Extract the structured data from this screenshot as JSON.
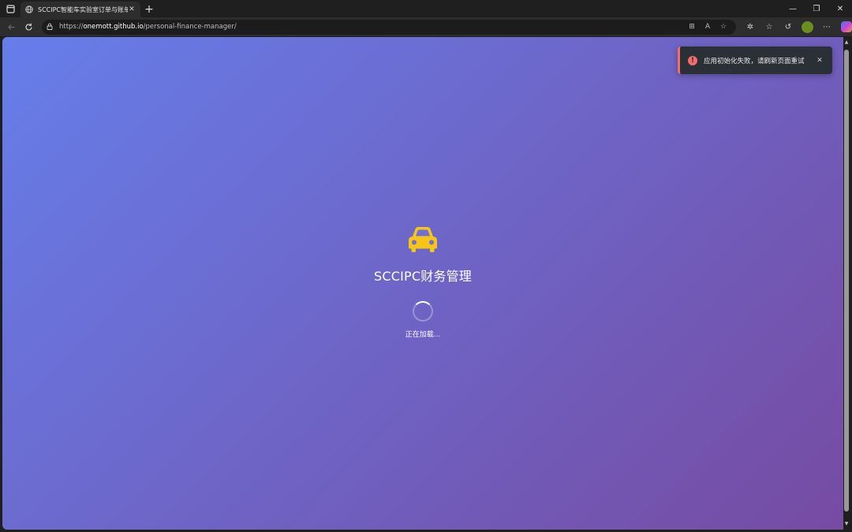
{
  "browser": {
    "tab_title": "SCCIPC智能车实验室订单与账单管",
    "tab_close": "✕",
    "new_tab": "+",
    "url_prefix": "https://",
    "url_host": "onemott.github.io",
    "url_path": "/personal-finance-manager/",
    "window_controls": {
      "minimize": "—",
      "restore": "❐",
      "close": "✕"
    }
  },
  "page": {
    "app_name": "SCCIPC财务管理",
    "loading_text": "正在加载...",
    "icon": "car-icon",
    "icon_color": "#f5c518",
    "gradient_start": "#667eea",
    "gradient_end": "#764ba2"
  },
  "toast": {
    "type": "error",
    "message": "应用初始化失败，请刷新页面重试",
    "icon_glyph": "!",
    "close_glyph": "✕",
    "accent_color": "#f56c6c"
  }
}
